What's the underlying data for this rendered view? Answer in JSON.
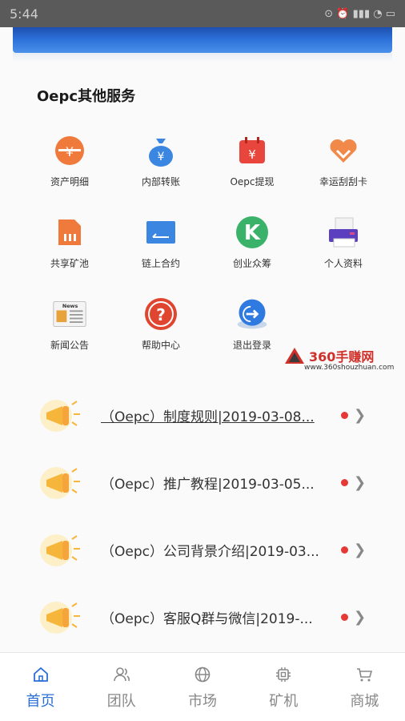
{
  "status": {
    "time": "5:44",
    "indicators": "⊙ ⏰ ▮▮▮ ◔ ▭"
  },
  "section": {
    "title": "Oepc其他服务"
  },
  "grid": [
    {
      "label": "资产明细",
      "icon": "asset-detail-icon"
    },
    {
      "label": "内部转账",
      "icon": "money-bag-icon"
    },
    {
      "label": "Oepc提现",
      "icon": "calendar-yuan-icon"
    },
    {
      "label": "幸运刮刮卡",
      "icon": "heart-icon"
    },
    {
      "label": "共享矿池",
      "icon": "sim-card-icon"
    },
    {
      "label": "链上合约",
      "icon": "contract-icon"
    },
    {
      "label": "创业众筹",
      "icon": "k-circle-icon"
    },
    {
      "label": "个人资料",
      "icon": "printer-icon"
    },
    {
      "label": "新闻公告",
      "icon": "news-icon"
    },
    {
      "label": "帮助中心",
      "icon": "help-icon"
    },
    {
      "label": "退出登录",
      "icon": "logout-icon"
    }
  ],
  "watermark": {
    "brand": "360手赚网",
    "url": "www.360shouzhuan.com"
  },
  "news": [
    {
      "title": "（Oepc）制度规则|2019-03-08..."
    },
    {
      "title": "（Oepc）推广教程|2019-03-05..."
    },
    {
      "title": "（Oepc）公司背景介绍|2019-03..."
    },
    {
      "title": "（Oepc）客服Q群与微信|2019-..."
    }
  ],
  "tabs": [
    {
      "label": "首页",
      "icon": "home-icon"
    },
    {
      "label": "团队",
      "icon": "team-icon"
    },
    {
      "label": "市场",
      "icon": "globe-icon"
    },
    {
      "label": "矿机",
      "icon": "chip-icon"
    },
    {
      "label": "商城",
      "icon": "cart-icon"
    }
  ],
  "colors": {
    "accent": "#2a6fd6",
    "dot": "#e53935"
  }
}
